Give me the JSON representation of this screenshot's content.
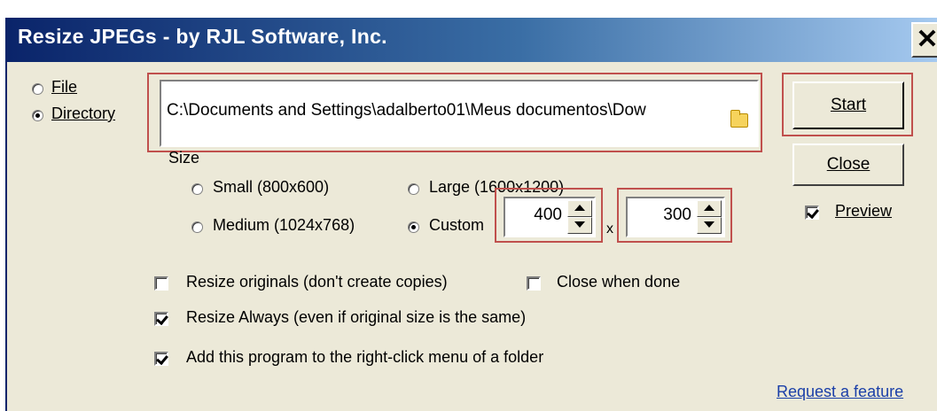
{
  "window": {
    "title": "Resize JPEGs - by RJL Software, Inc.",
    "close_label": "✕"
  },
  "source": {
    "file_label": "File",
    "directory_label": "Directory",
    "selected": "Directory",
    "path_value": "C:\\Documents and Settings\\adalberto01\\Meus documentos\\Dow"
  },
  "size": {
    "group_label": "Size",
    "small_label": "Small (800x600)",
    "large_label": "Large (1600x1200)",
    "medium_label": "Medium (1024x768)",
    "custom_label": "Custom",
    "selected": "Custom",
    "custom_width": "400",
    "custom_height": "300",
    "times_label": "x"
  },
  "options": {
    "resize_originals_label": "Resize originals (don't create copies)",
    "resize_originals_checked": false,
    "close_when_done_label": "Close when done",
    "close_when_done_checked": false,
    "resize_always_label": "Resize Always (even if original size is the same)",
    "resize_always_checked": true,
    "add_context_menu_label": "Add this program to the right-click menu of a folder",
    "add_context_menu_checked": true
  },
  "buttons": {
    "start_label": "Start",
    "close_label": "Close",
    "preview_label": "Preview",
    "preview_checked": true
  },
  "link": {
    "request_feature_label": "Request a feature"
  },
  "colors": {
    "highlight_box": "#c0504d",
    "dialog_bg": "#ece9d8",
    "link": "#1a3fa8"
  }
}
